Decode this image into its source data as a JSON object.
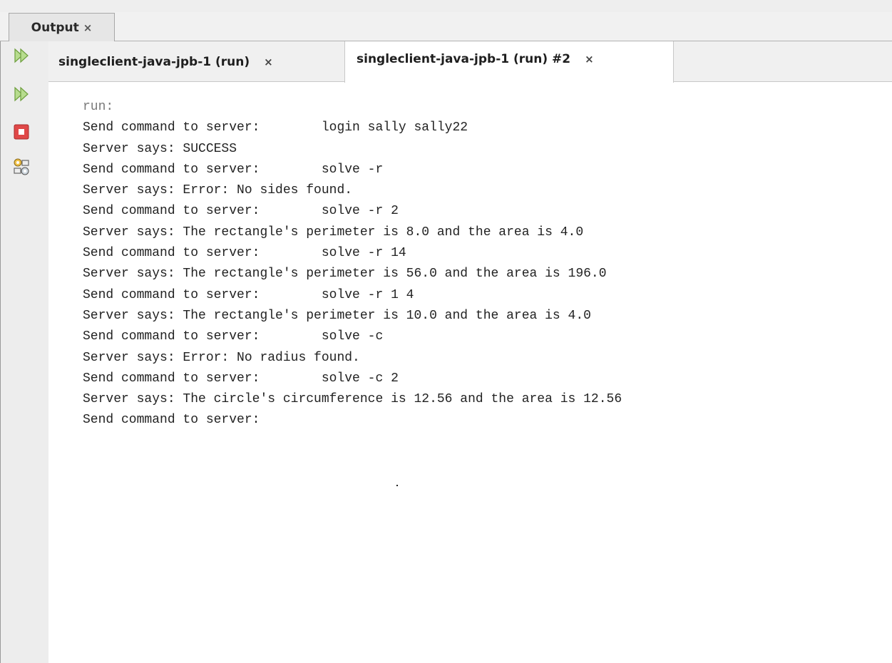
{
  "panel": {
    "title": "Output",
    "close_symbol": "×"
  },
  "tabs": [
    {
      "label": "singleclient-java-jpb-1 (run)",
      "close_symbol": "×",
      "active": false
    },
    {
      "label": "singleclient-java-jpb-1 (run) #2",
      "close_symbol": "×",
      "active": true
    }
  ],
  "left_toolbar": [
    {
      "icon": "rerun-icon"
    },
    {
      "icon": "rerun-with-options-icon"
    },
    {
      "icon": "stop-icon"
    },
    {
      "icon": "settings-icon"
    }
  ],
  "console": {
    "lines": [
      "run:",
      "Send command to server:        login sally sally22",
      "Server says: SUCCESS",
      "Send command to server:        solve -r",
      "Server says: Error: No sides found.",
      "Send command to server:        solve -r 2",
      "Server says: The rectangle's perimeter is 8.0 and the area is 4.0",
      "Send command to server:        solve -r 14",
      "Server says: The rectangle's perimeter is 56.0 and the area is 196.0",
      "Send command to server:        solve -r 1 4",
      "Server says: The rectangle's perimeter is 10.0 and the area is 4.0",
      "Send command to server:        solve -c",
      "Server says: Error: No radius found.",
      "Send command to server:        solve -c 2",
      "Server says: The circle's circumference is 12.56 and the area is 12.56",
      "Send command to server:"
    ]
  },
  "colors": {
    "stop_red": "#e04848",
    "rerun_green": "#8fc35a",
    "run_text": "#7a7a7a"
  }
}
